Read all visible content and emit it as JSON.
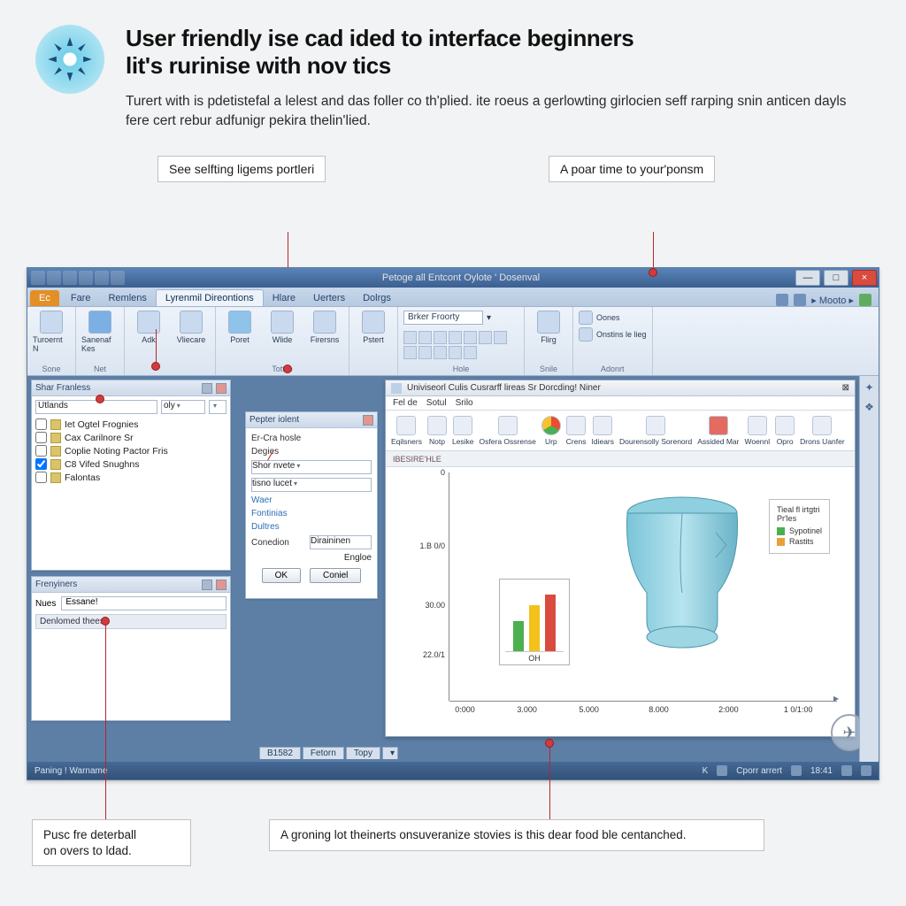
{
  "article": {
    "title_line1": "User friendly ise cad ided to interface beginners",
    "title_line2": "lit's rurinise with nov tics",
    "body": "Turert with is pdetistefal a lelest and das foller co th'plied. ite roeus a gerlowting girlocien seff rarping snin anticen dayls fere cert rebur adfunigr pekira thelin'lied."
  },
  "callouts": {
    "top_left": "See selfting ligems portleri",
    "top_right": "A poar time to your'ponsm",
    "bottom_left_l1": "Pusc fre deterball",
    "bottom_left_l2": "on overs to ldad.",
    "bottom_right": "A groning lot theinerts onsuveranize stovies is this dear food ble centanched."
  },
  "window": {
    "title": "Petoge all Entcont Oylote ' Dosenval",
    "minimize": "—",
    "maximize": "□",
    "close": "×",
    "menu_mode": "Mooto"
  },
  "tabs": {
    "file": "Ec",
    "items": [
      "Fare",
      "Remlens",
      "Lyrenmil Direontions",
      "Hlare",
      "Uerters",
      "Dolrgs"
    ],
    "active_index": 2
  },
  "ribbon_groups": [
    {
      "label": "Sone",
      "buttons": [
        "Turoernt N"
      ]
    },
    {
      "label": "Net",
      "buttons": [
        "Sanenaf Kes"
      ]
    },
    {
      "label": "",
      "buttons": [
        "Adk",
        "Vliecare"
      ]
    },
    {
      "label": "Tottlie",
      "buttons": [
        "Poret",
        "Wlide",
        "Firersns"
      ]
    },
    {
      "label": "",
      "buttons": [
        "Pstert"
      ]
    },
    {
      "label": "Hole",
      "dropdown": "Brker Froorty"
    },
    {
      "label": "Snile",
      "buttons": [
        "Flirg"
      ]
    },
    {
      "label": "Adonrt",
      "mini": [
        "Oones",
        "Onstins le lieg"
      ]
    }
  ],
  "left_panel": {
    "title": "Shar Franless",
    "dd1": "Utlands",
    "dd2": "oly",
    "items": [
      {
        "label": "Iet Ogtel Frognies",
        "checked": false
      },
      {
        "label": "Cax Carilnore Sr",
        "checked": false
      },
      {
        "label": "Coplie Noting Pactor Fris",
        "checked": false
      },
      {
        "label": "C8 Vifed Snughns",
        "checked": true
      },
      {
        "label": "Falontas",
        "checked": false
      }
    ]
  },
  "bottom_left_panel": {
    "title": "Frenyiners",
    "name_label": "Nues",
    "name_value": "Essane!",
    "section": "Denlomed thees"
  },
  "mini_dialog": {
    "title": "Pepter iolent",
    "rows": [
      "Er-Cra hosle",
      "Degies",
      "Shor nvete",
      "tisno lucet",
      "Waer",
      "Fontinias",
      "Dultres"
    ],
    "footer_label": "Conedion",
    "footer_dd": "Diraininen",
    "more": "Engloe",
    "ok": "OK",
    "cancel": "Coniel"
  },
  "doc": {
    "title": "Univiseorl Culis Cusrarff lireas Sr Dorcding! Niner",
    "menu": [
      "Fel de",
      "Sotul",
      "Srilo"
    ],
    "toolbar": [
      {
        "label": "Eqilsners",
        "icon": "gear"
      },
      {
        "label": "Notp",
        "icon": "doc"
      },
      {
        "label": "Lesike",
        "icon": "grid"
      },
      {
        "label": "Osfera Ossrense",
        "icon": "badge"
      },
      {
        "label": "Urp",
        "icon": "chrome"
      },
      {
        "label": "Crens",
        "icon": "ring"
      },
      {
        "label": "Idiears",
        "icon": "box"
      },
      {
        "label": "Dourensolly Sorenord",
        "icon": "tile"
      },
      {
        "label": "Assided Mar",
        "icon": "redstop"
      },
      {
        "label": "Woennl",
        "icon": "wrench"
      },
      {
        "label": "Opro",
        "icon": "pencil"
      },
      {
        "label": "Drons Uanfer",
        "icon": "layers"
      }
    ],
    "subtab": "IBESIRE'HLE",
    "bottom_tabs": [
      "B1582",
      "Fetorn",
      "Topy"
    ]
  },
  "chart_data": {
    "type": "bar",
    "yticks": [
      0,
      1800,
      3000,
      2200
    ],
    "yticks_display": [
      "0",
      "1.B 0/0",
      "30.00",
      "22.0/1"
    ],
    "xticks": [
      0,
      3000,
      5000,
      8000,
      2000,
      10100
    ],
    "xticks_display": [
      "0:000",
      "3.000",
      "5.000",
      "8.000",
      "2:000",
      "1 0/1:00"
    ],
    "mini_bars": {
      "categories": [
        "",
        "",
        ""
      ],
      "values": [
        45,
        70,
        85
      ],
      "colors": [
        "#4caf50",
        "#f3c11b",
        "#d94b3e"
      ],
      "caption": "OH"
    },
    "legend": {
      "title_l1": "Tieal fl irtgtri",
      "title_l2": "Pr'les",
      "items": [
        {
          "label": "Sypotinel",
          "color": "#4caf50"
        },
        {
          "label": "Rastits",
          "color": "#e8a13a"
        }
      ]
    }
  },
  "status": {
    "left": "Paning ! Warname",
    "mid": "Cporr arrert",
    "time": "18:41"
  }
}
